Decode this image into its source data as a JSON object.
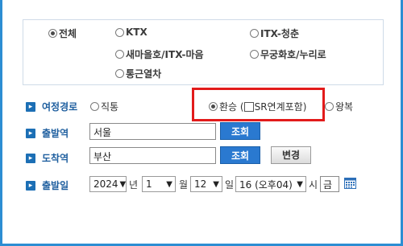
{
  "train_types": [
    {
      "label": "전체",
      "selected": true
    },
    {
      "label": "KTX",
      "selected": false
    },
    {
      "label": "ITX-청춘",
      "selected": false
    },
    {
      "label": "새마을호/ITX-마음",
      "selected": false
    },
    {
      "label": "무궁화호/누리로",
      "selected": false
    },
    {
      "label": "통근열차",
      "selected": false
    }
  ],
  "route": {
    "label": "여정경로",
    "options": {
      "direct": {
        "label": "직통",
        "selected": false
      },
      "transfer": {
        "label": "환승 (",
        "selected": true
      },
      "sr_link": {
        "label": "SR연계포함)",
        "checked": false
      },
      "round_trip": {
        "label": "왕복",
        "selected": false
      }
    }
  },
  "departure": {
    "label": "출발역",
    "value": "서울",
    "search_label": "조회"
  },
  "arrival": {
    "label": "도착역",
    "value": "부산",
    "search_label": "조회",
    "swap_label": "변경"
  },
  "date": {
    "label": "출발일",
    "year": "2024",
    "year_unit": "년",
    "month": "1",
    "month_unit": "월",
    "day": "12",
    "day_unit": "일",
    "hour": "16 (오후04)",
    "hour_unit": "시",
    "weekday": "금"
  },
  "colors": {
    "accent": "#2c8ed3",
    "button": "#2a79d0",
    "highlight": "#e21b1b",
    "label": "#1f5f9f"
  },
  "icons": {
    "section_marker": "chevron-right-icon",
    "calendar": "calendar-icon"
  }
}
